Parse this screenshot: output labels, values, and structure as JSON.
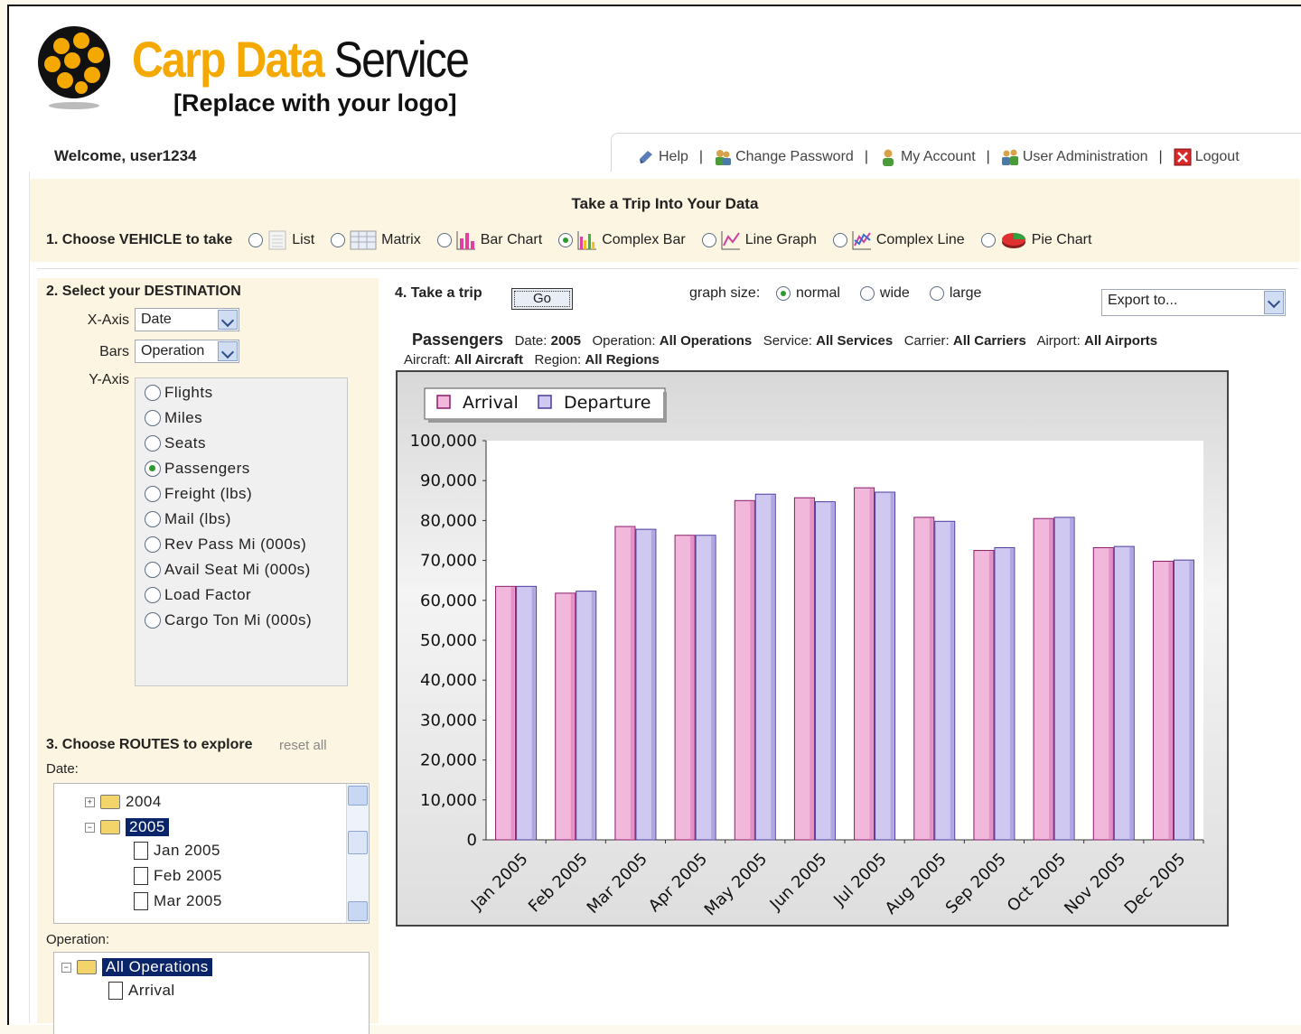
{
  "header": {
    "logo_name_orange": "Carp Data",
    "logo_name_black": "Service",
    "logo_sub": "[Replace with your logo]",
    "welcome": "Welcome, user1234"
  },
  "topnav": {
    "help": "Help",
    "change_password": "Change Password",
    "my_account": "My Account",
    "user_admin": "User Administration",
    "logout": "Logout",
    "separator": "|"
  },
  "vehicle": {
    "title": "Take a Trip Into Your Data",
    "label": "1. Choose VEHICLE to take",
    "options": [
      {
        "label": "List",
        "selected": false,
        "icon": "list-icon"
      },
      {
        "label": "Matrix",
        "selected": false,
        "icon": "matrix-icon"
      },
      {
        "label": "Bar Chart",
        "selected": false,
        "icon": "bar-chart-icon"
      },
      {
        "label": "Complex Bar",
        "selected": true,
        "icon": "complex-bar-icon"
      },
      {
        "label": "Line Graph",
        "selected": false,
        "icon": "line-graph-icon"
      },
      {
        "label": "Complex Line",
        "selected": false,
        "icon": "complex-line-icon"
      },
      {
        "label": "Pie Chart",
        "selected": false,
        "icon": "pie-chart-icon"
      }
    ]
  },
  "destination": {
    "label": "2. Select your DESTINATION",
    "xaxis_label": "X-Axis",
    "xaxis_value": "Date",
    "bars_label": "Bars",
    "bars_value": "Operation",
    "yaxis_label": "Y-Axis",
    "yaxis_options": [
      "Flights",
      "Miles",
      "Seats",
      "Passengers",
      "Freight (lbs)",
      "Mail (lbs)",
      "Rev Pass Mi (000s)",
      "Avail Seat Mi (000s)",
      "Load Factor",
      "Cargo Ton Mi (000s)"
    ],
    "yaxis_selected": "Passengers"
  },
  "routes": {
    "label": "3. Choose ROUTES to explore",
    "reset": "reset all",
    "date_label": "Date:",
    "date_nodes": [
      "2004",
      "2005",
      "Jan 2005",
      "Feb 2005",
      "Mar 2005"
    ],
    "operation_label": "Operation:",
    "operation_nodes": [
      "All Operations",
      "Arrival"
    ]
  },
  "trip": {
    "label": "4. Take a trip",
    "go": "Go",
    "graph_size_label": "graph size:",
    "sizes": [
      {
        "label": "normal",
        "selected": true
      },
      {
        "label": "wide",
        "selected": false
      },
      {
        "label": "large",
        "selected": false
      }
    ],
    "export": "Export to..."
  },
  "chart_header": {
    "metric": "Passengers",
    "date_label": "Date:",
    "date_value": "2005",
    "operation_label": "Operation:",
    "operation_value": "All Operations",
    "service_label": "Service:",
    "service_value": "All Services",
    "carrier_label": "Carrier:",
    "carrier_value": "All Carriers",
    "airport_label": "Airport:",
    "airport_value": "All Airports",
    "aircraft_label": "Aircraft:",
    "aircraft_value": "All Aircraft",
    "region_label": "Region:",
    "region_value": "All Regions"
  },
  "colors": {
    "arrival": "#f2b8dc",
    "departure": "#cfc8f0",
    "logo_orange": "#f5a800",
    "selection": "#0a246a"
  },
  "chart_data": {
    "type": "bar",
    "categories": [
      "Jan 2005",
      "Feb 2005",
      "Mar 2005",
      "Apr 2005",
      "May 2005",
      "Jun 2005",
      "Jul 2005",
      "Aug 2005",
      "Sep 2005",
      "Oct 2005",
      "Nov 2005",
      "Dec 2005"
    ],
    "series": [
      {
        "name": "Arrival",
        "values": [
          63500,
          61800,
          78500,
          76300,
          85000,
          85700,
          88200,
          80800,
          72500,
          80500,
          73200,
          69800
        ]
      },
      {
        "name": "Departure",
        "values": [
          63500,
          62300,
          77800,
          76300,
          86600,
          84700,
          87100,
          79800,
          73200,
          80800,
          73500,
          70100
        ]
      }
    ],
    "ylim": [
      0,
      100000
    ],
    "yticks": [
      "100,000",
      "90,000",
      "80,000",
      "70,000",
      "60,000",
      "50,000",
      "40,000",
      "30,000",
      "20,000",
      "10,000",
      "0"
    ],
    "legend": "top-left",
    "grid": false
  }
}
